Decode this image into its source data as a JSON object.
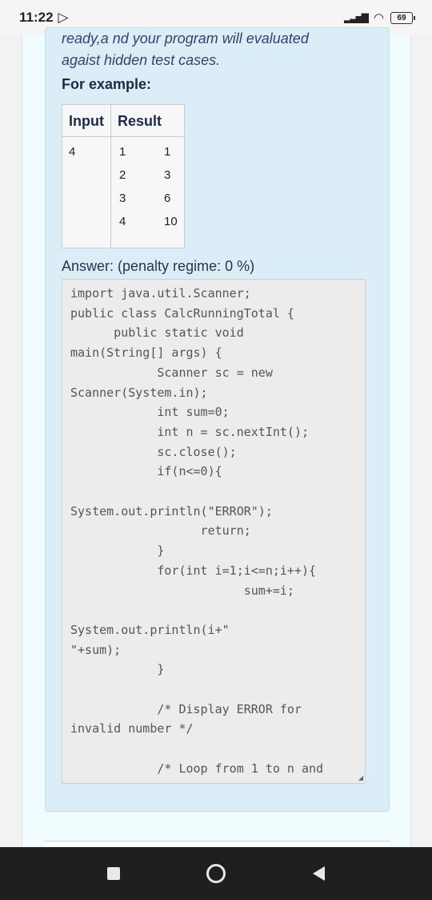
{
  "status_bar": {
    "time": "11:22",
    "play_icon": "▷",
    "signal_icon": "signal-bars",
    "wifi_icon": "wifi",
    "battery": "69"
  },
  "question": {
    "prompt_line1": "ready,a nd your program will evaluated",
    "prompt_line2": "agaist hidden test cases.",
    "example_heading": "For example:",
    "table": {
      "headers": [
        "Input",
        "Result"
      ],
      "input": "4",
      "result_rows": [
        [
          "1",
          "1"
        ],
        [
          "2",
          "3"
        ],
        [
          "3",
          "6"
        ],
        [
          "4",
          "10"
        ]
      ]
    },
    "answer_label": "Answer:  (penalty regime: 0 %)"
  },
  "code": {
    "lines": [
      "import java.util.Scanner;",
      "public class CalcRunningTotal {",
      "      public static void",
      "main(String[] args) {",
      "            Scanner sc = new",
      "Scanner(System.in);",
      "            int sum=0;",
      "            int n = sc.nextInt();",
      "            sc.close();",
      "            if(n<=0){",
      "",
      "System.out.println(\"ERROR\");",
      "                  return;",
      "            }",
      "            for(int i=1;i<=n;i++){",
      "                        sum+=i;",
      "",
      "System.out.println(i+\"",
      "\"+sum);",
      "            }",
      "",
      "            /* Display ERROR for",
      "invalid number */",
      "",
      "            /* Loop from 1 to n and"
    ]
  },
  "nav": {
    "recents_icon": "square",
    "home_icon": "circle",
    "back_icon": "triangle-left"
  }
}
